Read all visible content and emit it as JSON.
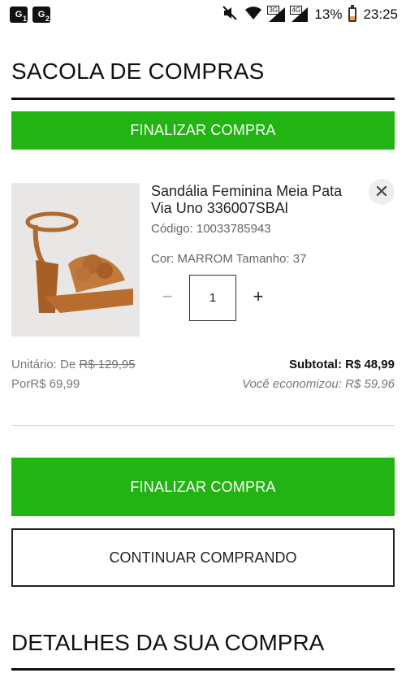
{
  "status_bar": {
    "sim1": "1",
    "sim2": "2",
    "network_3g": "3G",
    "network_4g": "4G",
    "battery": "13%",
    "time": "23:25"
  },
  "page": {
    "title": "SACOLA DE COMPRAS",
    "checkout_label": "FINALIZAR COMPRA"
  },
  "item": {
    "name": "Sandália Feminina Meia Pata Via Uno 336007SBAl",
    "code": "Código: 10033785943",
    "variant": "Cor: MARROM Tamanho: 37",
    "quantity": "1",
    "qty_minus": "−",
    "qty_plus": "+",
    "remove": "✕"
  },
  "pricing": {
    "unit_label": "Unitário: De ",
    "old_price": "R$ 129,95",
    "new_price": "PorR$ 69,99",
    "subtotal": "Subtotal: R$ 48,99",
    "saved": "Você economizou: R$ 59,96"
  },
  "actions": {
    "checkout_label": "FINALIZAR COMPRA",
    "continue_label": "CONTINUAR COMPRANDO"
  },
  "details": {
    "title": "DETALHES DA SUA COMPRA"
  },
  "colors": {
    "green": "#22b412",
    "dark": "#111111"
  }
}
